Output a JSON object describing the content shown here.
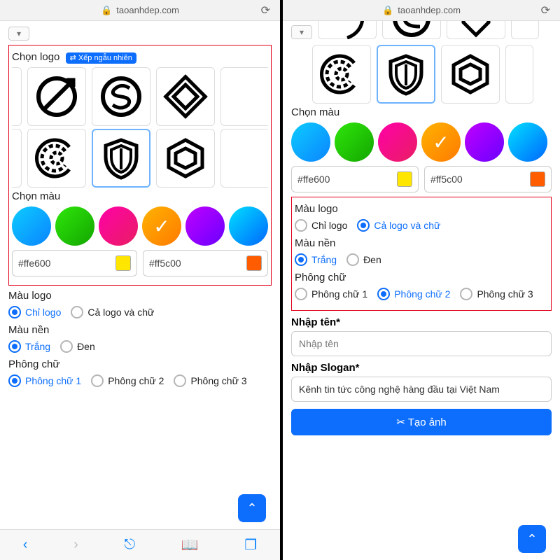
{
  "url": "taoanhdep.com",
  "left": {
    "chon_logo_label": "Chọn logo",
    "shuffle_badge": "⇄ Xếp ngẫu nhiên",
    "chon_mau_label": "Chọn màu",
    "hex1": "#ffe600",
    "hex2": "#ff5c00",
    "mau_logo_label": "Màu logo",
    "mau_logo_options": {
      "opt1": "Chỉ logo",
      "opt2": "Cả logo và chữ"
    },
    "mau_nen_label": "Màu nền",
    "mau_nen_options": {
      "opt1": "Trắng",
      "opt2": "Đen"
    },
    "phong_chu_label": "Phông chữ",
    "phong_chu_options": {
      "opt1": "Phông chữ 1",
      "opt2": "Phông chữ 2",
      "opt3": "Phông chữ 3"
    }
  },
  "right": {
    "chon_mau_label": "Chọn màu",
    "hex1": "#ffe600",
    "hex2": "#ff5c00",
    "mau_logo_label": "Màu logo",
    "mau_logo_options": {
      "opt1": "Chỉ logo",
      "opt2": "Cả logo và chữ"
    },
    "mau_nen_label": "Màu nền",
    "mau_nen_options": {
      "opt1": "Trắng",
      "opt2": "Đen"
    },
    "phong_chu_label": "Phông chữ",
    "phong_chu_options": {
      "opt1": "Phông chữ 1",
      "opt2": "Phông chữ 2",
      "opt3": "Phông chữ 3"
    },
    "nhap_ten_label": "Nhập tên*",
    "nhap_ten_placeholder": "Nhập tên",
    "nhap_slogan_label": "Nhập Slogan*",
    "slogan_value": "Kênh tin tức công nghệ hàng đầu tại Việt Nam",
    "create_button": "✂ Tạo ảnh"
  }
}
